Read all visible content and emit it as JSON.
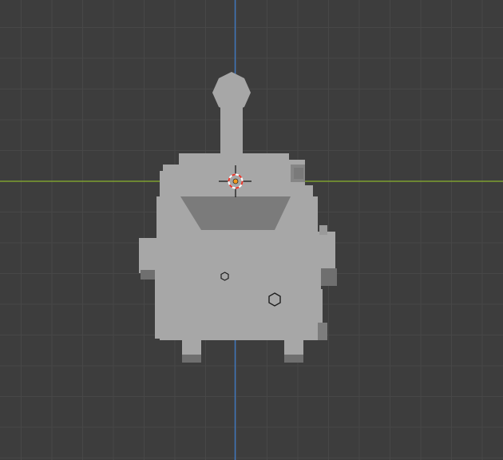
{
  "app": {
    "name": "3D Viewport",
    "view": "top-orthographic"
  },
  "colors": {
    "background": "#3d3d3d",
    "grid": "#474747",
    "x_axis": "#8ab32e",
    "y_axis": "#3f7cc9",
    "model_light": "#a7a7a7",
    "model_mid": "#9a9a9a",
    "model_dark": "#6f6f6f",
    "model_recess": "#7b7b7b",
    "cursor_red": "#e8352a",
    "origin_orange": "#f39a1c"
  },
  "scene": {
    "object": "blocky-creature-mesh",
    "cursor": "3d-cursor",
    "origin": "object-origin"
  }
}
